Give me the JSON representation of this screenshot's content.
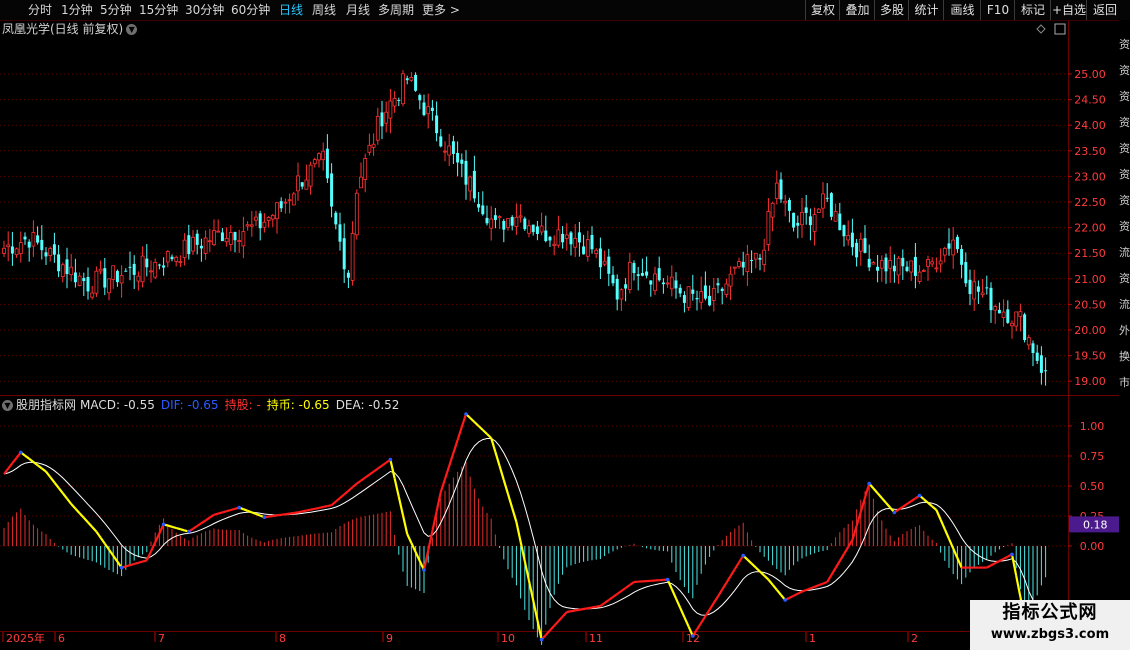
{
  "toolbar": {
    "periods": [
      {
        "label": "分时"
      },
      {
        "label": "1分钟"
      },
      {
        "label": "5分钟"
      },
      {
        "label": "15分钟"
      },
      {
        "label": "30分钟"
      },
      {
        "label": "60分钟"
      },
      {
        "label": "日线",
        "active": true
      },
      {
        "label": "周线"
      },
      {
        "label": "月线"
      },
      {
        "label": "多周期"
      },
      {
        "label": "更多 >"
      }
    ],
    "actions": [
      {
        "label": "复权"
      },
      {
        "label": "叠加"
      },
      {
        "label": "多股"
      },
      {
        "label": "统计"
      },
      {
        "label": "画线"
      },
      {
        "label": "F10"
      },
      {
        "label": "标记"
      },
      {
        "label": "+自选"
      },
      {
        "label": "返回"
      }
    ]
  },
  "main_chart": {
    "title": "凤凰光学(日线 前复权)",
    "price_axis": [
      "25.00",
      "24.50",
      "24.00",
      "23.50",
      "23.00",
      "22.50",
      "22.00",
      "21.50",
      "21.00",
      "20.50",
      "20.00",
      "19.50",
      "19.00"
    ]
  },
  "indicator": {
    "name": "股朋指标网",
    "macd": "MACD: -0.55",
    "dif": "DIF: -0.65",
    "hold_stock": "持股: -",
    "hold_cash": "持币: -0.65",
    "dea": "DEA: -0.52",
    "axis": [
      "1.00",
      "0.75",
      "0.50",
      "0.25",
      "0.00"
    ],
    "current_value": "0.18"
  },
  "date_axis": [
    "2025年",
    "6",
    "7",
    "8",
    "9",
    "10",
    "11",
    "12",
    "1",
    "2"
  ],
  "side_strip": [
    "资",
    "资",
    "资",
    "资",
    "资",
    "资",
    "资",
    "资",
    "流",
    "资",
    "流",
    "外",
    "换",
    "市"
  ],
  "watermark": {
    "title": "指标公式网",
    "url": "www.zbgs3.com"
  },
  "colors": {
    "up": "#ff3232",
    "down": "#54ffff",
    "grid": "#5a0000",
    "dif_up": "#ff1a1a",
    "dif_down": "#ffff00",
    "dea": "#ffffff",
    "label_red": "#ff3232",
    "label_blue": "#2b5bff",
    "label_yellow": "#ffff00",
    "label_white": "#dddddd",
    "highlight": "#4b1a8c"
  }
}
